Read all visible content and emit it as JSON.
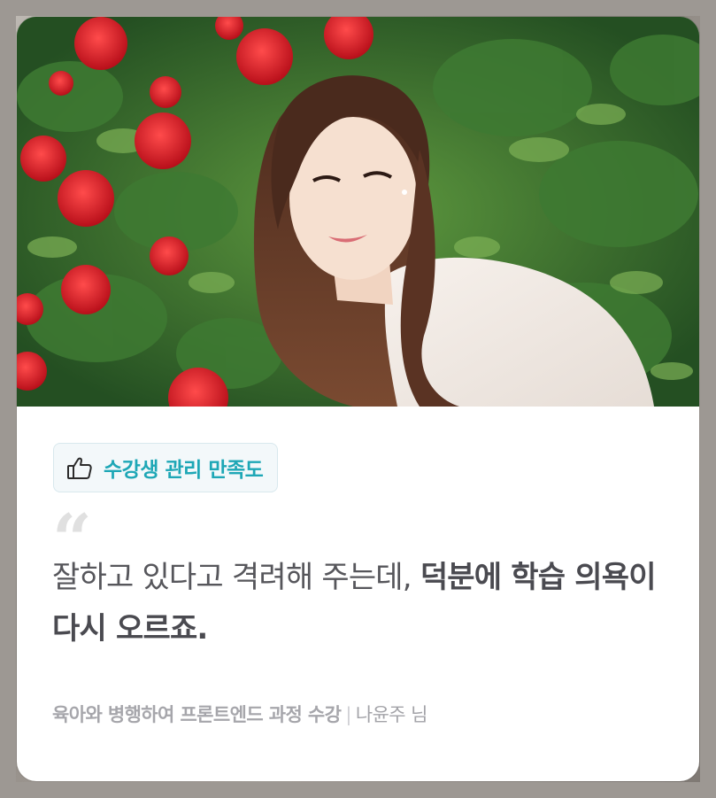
{
  "badge": {
    "icon": "thumbs-up-icon",
    "label": "수강생 관리 만족도",
    "color": "#1ea7b6"
  },
  "testimonial": {
    "quote_mark": "“",
    "text_regular": "잘하고 있다고 격려해 주는데, ",
    "text_bold": "덕분에 학습 의욕이 다시 오르죠.",
    "course": "육아와 병행하여 프론트엔드 과정 수강",
    "separator": "|",
    "author": "나윤주 님"
  },
  "photo": {
    "subject": "portrait-photo"
  }
}
